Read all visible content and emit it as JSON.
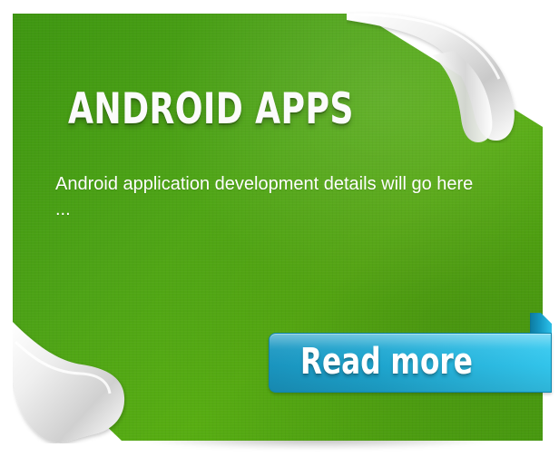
{
  "promo": {
    "title": "ANDROID APPS",
    "description": "Android application development details will go here ...",
    "cta_label": "Read more"
  },
  "icons": {
    "top_curl": "page-curl-icon",
    "bottom_curl": "page-curl-icon",
    "ribbon": "ribbon-icon"
  },
  "colors": {
    "card_green": "#4da316",
    "card_dark_green": "#3e9611",
    "button_blue": "#1ea7d1",
    "button_light_blue": "#33c8ef",
    "text": "#ffffff"
  }
}
